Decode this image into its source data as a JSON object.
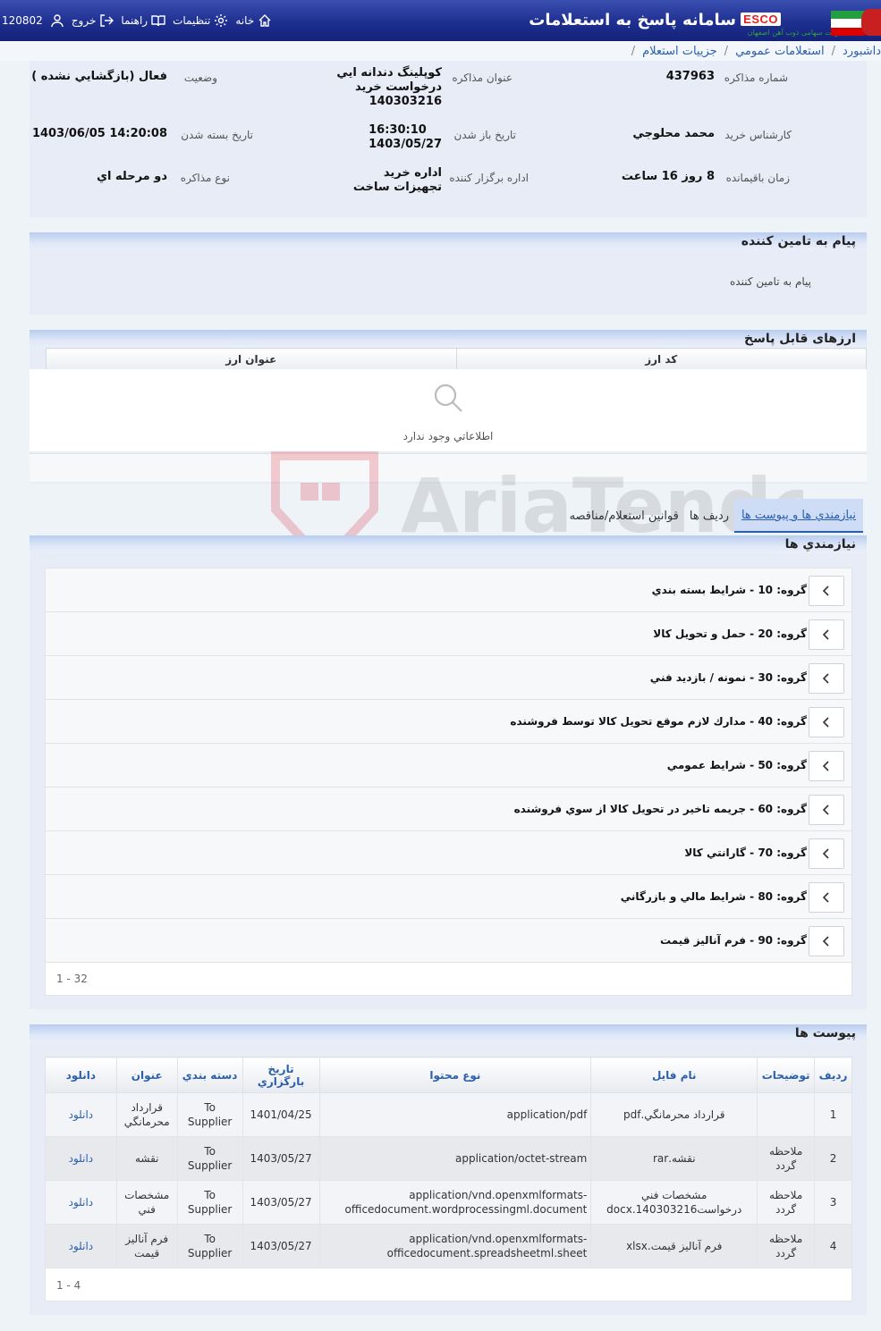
{
  "header": {
    "app_title": "سامانه پاسخ به استعلامات",
    "brand": "ESCO",
    "brand_sub": "شرکت سهامی ذوب آهن اصفهان",
    "nav": {
      "home": "خانه",
      "settings": "تنظیمات",
      "help": "راهنما",
      "logout": "خروج",
      "user_code": "120802"
    }
  },
  "breadcrumb": [
    "داشبورد",
    "استعلامات عمومي",
    "جزييات استعلام"
  ],
  "info": {
    "inquiry_number_label": "شماره مذاکره",
    "inquiry_number": "437963",
    "subject_label": "عنوان مذاکره",
    "subject": "کوپلینگ دندانه ايي درخواست خريد 140303216",
    "status_label": "وضعيت",
    "status": "فعال (بازگشايي نشده )",
    "buyer_label": "کارشناس خريد",
    "buyer": "محمد محلوجي",
    "open_date_label": "تاريخ باز شدن",
    "open_time": "16:30:10",
    "open_date": "1403/05/27",
    "close_date_label": "تاريخ بسته شدن",
    "close_date": "1403/06/05 14:20:08",
    "remaining_label": "زمان باقيمانده",
    "remaining": "8 روز 16 ساعت",
    "organizer_label": "اداره برگزار کننده",
    "organizer": "اداره خريد تجهيزات ساخت",
    "type_label": "نوع مذاکره",
    "type": "دو مرحله اي"
  },
  "supplier_message": {
    "title": "پيام به تامين کننده",
    "text": "پيام به تامين کننده"
  },
  "currencies": {
    "title": "ارزهای قابل پاسخ",
    "col_code": "کد ارز",
    "col_title": "عنوان ارز",
    "empty_text": "اطلاعاتي وجود ندارد"
  },
  "tabs": [
    "نيازمندي ها و پيوست ها",
    "رديف ها",
    "قوانين استعلام/مناقصه"
  ],
  "requirements": {
    "title": "نيازمندي ها",
    "groups": [
      "گروه: 10 - شرايط بسته بندي",
      "گروه: 20 - حمل و تحويل کالا",
      "گروه: 30 - نمونه / بازديد فني",
      "گروه: 40 - مدارك لازم موقع تحويل كالا توسط فروشنده",
      "گروه: 50 - شرايط عمومي",
      "گروه: 60 - جريمه تاخير در تحويل کالا از سوي فروشنده",
      "گروه: 70 - گارانتي کالا",
      "گروه: 80 - شرايط مالي و بازرگاني",
      "گروه: 90 - فرم آناليز قيمت"
    ],
    "pager": "1 - 32"
  },
  "attachments": {
    "title": "پيوست ها",
    "columns": [
      "رديف",
      "توضيحات",
      "نام فايل",
      "نوع محتوا",
      "تاريخ بارگزاري",
      "دسته بندي",
      "عنوان",
      "دانلود"
    ],
    "rows": [
      {
        "idx": "1",
        "desc": "",
        "file": "قرارداد محرمانگي.pdf",
        "type": "application/pdf",
        "date": "1401/04/25",
        "cat": "To Supplier",
        "title": "قرارداد محرمانگي",
        "dl": "دانلود"
      },
      {
        "idx": "2",
        "desc": "ملاحظه گردد",
        "file": "نقشه.rar",
        "type": "application/octet-stream",
        "date": "1403/05/27",
        "cat": "To Supplier",
        "title": "نقشه",
        "dl": "دانلود"
      },
      {
        "idx": "3",
        "desc": "ملاحظه گردد",
        "file": "مشخصات فني درخواست140303216.docx",
        "type": "application/vnd.openxmlformats-officedocument.wordprocessingml.document",
        "date": "1403/05/27",
        "cat": "To Supplier",
        "title": "مشخصات فني",
        "dl": "دانلود"
      },
      {
        "idx": "4",
        "desc": "ملاحظه گردد",
        "file": "فرم آناليز قيمت.xlsx",
        "type": "application/vnd.openxmlformats-officedocument.spreadsheetml.sheet",
        "date": "1403/05/27",
        "cat": "To Supplier",
        "title": "فرم آناليز قيمت",
        "dl": "دانلود"
      }
    ],
    "pager": "1 - 4"
  },
  "watermark": "AriaTender.neT",
  "colors": {
    "header": "#1e2f8f",
    "link": "#2a5fb0",
    "panel": "#e7ecf6"
  }
}
